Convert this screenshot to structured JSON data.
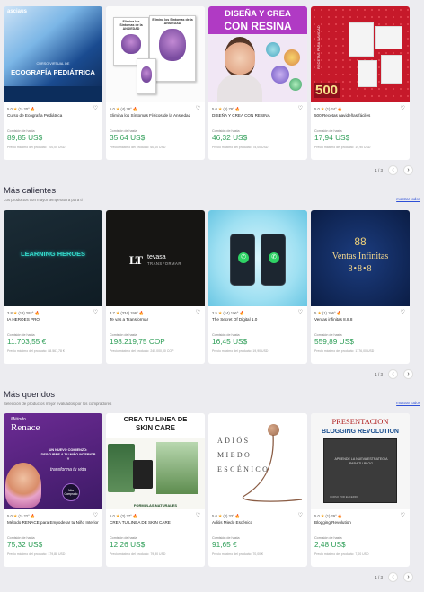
{
  "common": {
    "price_label": "Comisión de hasta",
    "star": "★",
    "fire": "🔥",
    "heart": "♡"
  },
  "section1": {
    "products": [
      {
        "name": "Curso de Ecografía Pediátrica",
        "rating": "5.0",
        "reviews": "(1)",
        "temp": "20°",
        "price": "89,85 US$",
        "commission_note": "Precio máximo del producto: 700,00 USD",
        "image": {
          "logo": "asciaus",
          "subtitle": "CURSO VIRTUAL DE",
          "title": "ECOGRAFÍA PEDIÁTRICA"
        }
      },
      {
        "name": "Elimina los Síntomas Físicos de la Ansiedad",
        "rating": "5.0",
        "reviews": "(4)",
        "temp": "78°",
        "price": "35,64 US$",
        "commission_note": "Precio máximo del producto: 60,00 USD",
        "image": {
          "book_title": "Elimina los Síntomas de la ANSIEDAD"
        }
      },
      {
        "name": "DISEÑA Y CREA CON RESINA",
        "rating": "5.0",
        "reviews": "(6)",
        "temp": "78°",
        "price": "46,32 US$",
        "commission_note": "Precio máximo del producto: 75,00 USD",
        "image": {
          "line1": "DISEÑA Y CREA",
          "line2": "CON RESINA"
        }
      },
      {
        "name": "500 Recetas navideñas fáciles",
        "rating": "5.0",
        "reviews": "(1)",
        "temp": "24°",
        "price": "17,94 US$",
        "commission_note": "Precio máximo del producto: 19,90 USD",
        "image": {
          "number": "500",
          "label": "RECETAS PARA NAVIDAD"
        }
      }
    ],
    "pager": "1 / 3",
    "prev": "‹",
    "next": "›"
  },
  "section2": {
    "title": "Más calientes",
    "subtitle": "Los productos con mayor temperatura para ti",
    "more": "mostrar todos",
    "products": [
      {
        "name": "IA HEROES PRO",
        "rating": "3.8",
        "reviews": "(18)",
        "temp": "292°",
        "price": "11.703,55 €",
        "commission_note": "Precio máximo del producto: 88.567,78 €",
        "image": {
          "text": "LEARNING HEROES"
        }
      },
      {
        "name": "Te vas a Transformar",
        "rating": "3.7",
        "reviews": "(334)",
        "temp": "196°",
        "price": "198.219,75 COP",
        "commission_note": "Precio máximo del producto: 245.000,00 COP",
        "image": {
          "mark": "LT",
          "word1": "tevasa",
          "word2": "TRANSFORMAR"
        }
      },
      {
        "name": "The Secret Of Digital 1.0",
        "rating": "2.5",
        "reviews": "(14)",
        "temp": "196°",
        "price": "16,45 US$",
        "commission_note": "Precio máximo del producto: 19,90 USD",
        "image": {
          "icon": "✆"
        }
      },
      {
        "name": "Ventas infinitas 8.8.8",
        "rating": "5",
        "reviews": "(1)",
        "temp": "196°",
        "price": "559,89 US$",
        "commission_note": "Precio máximo del producto: 1776,00 USD",
        "image": {
          "symbol": "88",
          "line1": "Ventas Infinitas",
          "line2": "8•8•8"
        }
      }
    ],
    "pager": "1 / 3",
    "prev": "‹",
    "next": "›"
  },
  "section3": {
    "title": "Más queridos",
    "subtitle": "Selección de productos mejor evaluados por los compradores",
    "more": "mostrar todos",
    "products": [
      {
        "name": "Método RENACE para Empoderar tu Niño Interior",
        "rating": "5.0",
        "reviews": "(1)",
        "temp": "22°",
        "price": "75,32 US$",
        "commission_note": "Precio máximo del producto: 179,88 USD",
        "image": {
          "m1": "Método",
          "m2": "Renace",
          "tag": "UN NUEVO COMIENZO: DESCUBRE A TU NIÑO INTERIOR Y",
          "tag2": "transforma tu vida",
          "badge": "Más Comprado"
        }
      },
      {
        "name": "CREA TU LINEA DE SKIN CARE",
        "rating": "5.0",
        "reviews": "(2)",
        "temp": "37°",
        "price": "12,26 US$",
        "commission_note": "Precio máximo del producto: 79,90 USD",
        "image": {
          "h1": "CREA TU LINEA DE",
          "h2": "SKIN CARE",
          "footer": "FORMULAS NATURALES"
        }
      },
      {
        "name": "Adiós Miedo Escénico",
        "rating": "5.0",
        "reviews": "(2)",
        "temp": "33°",
        "price": "91,65 €",
        "commission_note": "Precio máximo del producto: 70,00 €",
        "image": {
          "l1": "ADIÓS",
          "l2": "MIEDO",
          "l3": "ESCÉNICO"
        }
      },
      {
        "name": "Blogging Revolution",
        "rating": "5.0",
        "reviews": "(1)",
        "temp": "29°",
        "price": "2,48 US$",
        "commission_note": "Precio máximo del producto: 7,00 USD",
        "image": {
          "pres": "PRESENTACION",
          "rev": "BLOGGING REVOLUTION",
          "cover": "APRENDE LA NUEVA ESTRATEGIA PARA TU BLOG",
          "author": "CURSO POR EL CERRO"
        }
      }
    ],
    "pager": "1 / 3",
    "prev": "‹",
    "next": "›"
  }
}
